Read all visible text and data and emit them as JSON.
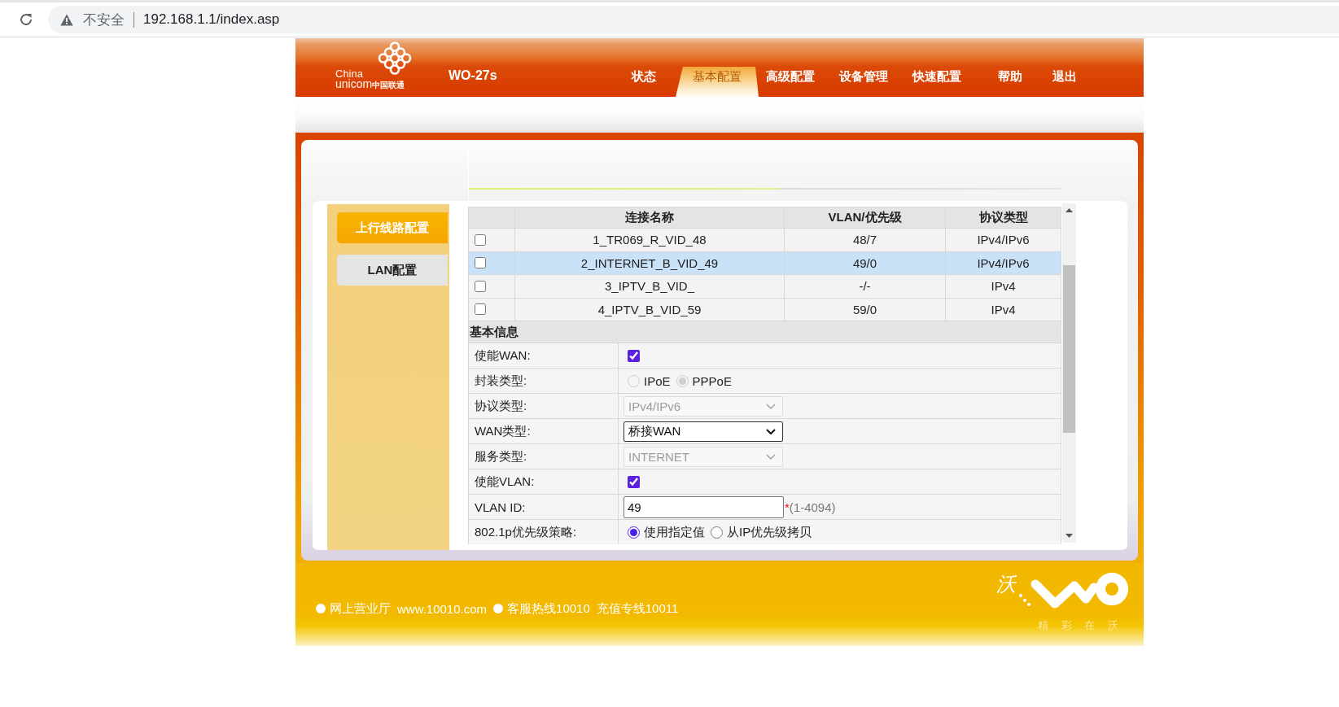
{
  "browser": {
    "security_label": "不安全",
    "url": "192.168.1.1/index.asp"
  },
  "header": {
    "logo": {
      "line_1": "China",
      "line_2": "unicom",
      "line_2_cn": "中国联通"
    },
    "model": "WO-27s",
    "nav": [
      {
        "label": "状态",
        "selected": false
      },
      {
        "label": "基本配置",
        "selected": true
      },
      {
        "label": "高级配置",
        "selected": false
      },
      {
        "label": "设备管理",
        "selected": false
      },
      {
        "label": "快速配置",
        "selected": false
      },
      {
        "label": "帮助",
        "selected": false
      },
      {
        "label": "退出",
        "selected": false
      }
    ]
  },
  "sidebar": {
    "items": [
      {
        "label": "上行线路配置",
        "selected": true
      },
      {
        "label": "LAN配置",
        "selected": false
      }
    ]
  },
  "connections": {
    "columns": [
      "连接名称",
      "VLAN/优先级",
      "协议类型"
    ],
    "rows": [
      {
        "checked": false,
        "selected": false,
        "name": "1_TR069_R_VID_48",
        "vlan": "48/7",
        "protocol": "IPv4/IPv6"
      },
      {
        "checked": false,
        "selected": true,
        "name": "2_INTERNET_B_VID_49",
        "vlan": "49/0",
        "protocol": "IPv4/IPv6"
      },
      {
        "checked": false,
        "selected": false,
        "name": "3_IPTV_B_VID_",
        "vlan": "-/-",
        "protocol": "IPv4"
      },
      {
        "checked": false,
        "selected": false,
        "name": "4_IPTV_B_VID_59",
        "vlan": "59/0",
        "protocol": "IPv4"
      }
    ]
  },
  "basic_info": {
    "title": "基本信息",
    "fields": [
      {
        "kind": "checkbox",
        "label": "使能WAN:",
        "checked": true
      },
      {
        "kind": "radio",
        "label": "封装类型:",
        "disabled": true,
        "options": [
          {
            "label": "IPoE",
            "selected": false
          },
          {
            "label": "PPPoE",
            "selected": true
          }
        ]
      },
      {
        "kind": "select",
        "label": "协议类型:",
        "disabled": true,
        "value": "IPv4/IPv6"
      },
      {
        "kind": "select",
        "label": "WAN类型:",
        "disabled": false,
        "value": "桥接WAN"
      },
      {
        "kind": "select",
        "label": "服务类型:",
        "disabled": true,
        "value": "INTERNET"
      },
      {
        "kind": "checkbox",
        "label": "使能VLAN:",
        "checked": true
      },
      {
        "kind": "text",
        "label": "VLAN ID:",
        "value": "49",
        "required_mark": "*",
        "hint": "(1-4094)"
      },
      {
        "kind": "radio",
        "label": "802.1p优先级策略:",
        "disabled": false,
        "options": [
          {
            "label": "使用指定值",
            "selected": true
          },
          {
            "label": "从IP优先级拷贝",
            "selected": false
          }
        ]
      }
    ]
  },
  "footer": {
    "contacts": [
      {
        "texts": [
          "网上营业厅",
          "www.10010.com"
        ]
      },
      {
        "texts": [
          "客服热线10010",
          "充值专线10011"
        ]
      }
    ],
    "brand": {
      "mark": "沃",
      "slogan": "精 彩 在 沃"
    }
  }
}
